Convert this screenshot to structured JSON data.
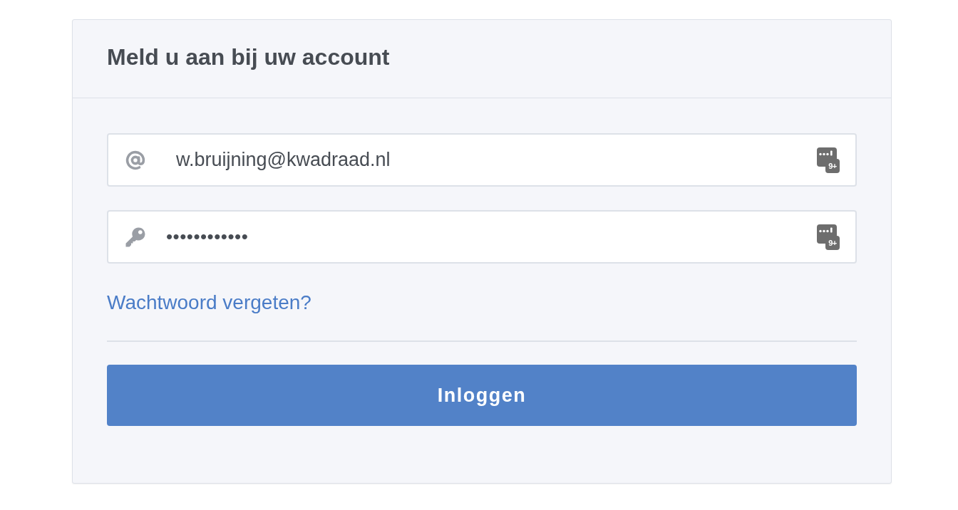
{
  "login_card": {
    "title": "Meld u aan bij uw account",
    "fields": [
      {
        "kind": "email",
        "value": "w.bruijning@kwadraad.nl",
        "badge": "9+"
      },
      {
        "kind": "password",
        "value": "••••••••••••",
        "badge": "9+"
      }
    ],
    "forgot_password_link": "Wachtwoord vergeten?",
    "submit_button": "Inloggen"
  }
}
